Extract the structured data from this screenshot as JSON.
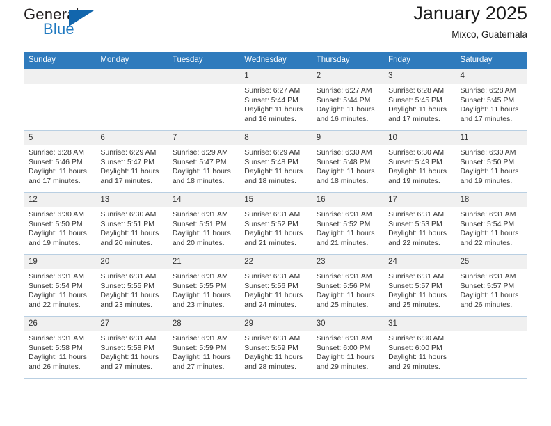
{
  "logo": {
    "word_top": "General",
    "word_bottom": "Blue",
    "triangle_color": "#1266ad",
    "blue_color": "#1f79c0"
  },
  "header": {
    "title": "January 2025",
    "subtitle": "Mixco, Guatemala"
  },
  "theme": {
    "header_row_bg": "#2f7bbd",
    "header_row_text": "#ffffff",
    "daynum_bg": "#f0f0f0",
    "cell_border": "#b9cfe2"
  },
  "calendar": {
    "weekday_headers": [
      "Sunday",
      "Monday",
      "Tuesday",
      "Wednesday",
      "Thursday",
      "Friday",
      "Saturday"
    ],
    "weeks": [
      [
        {
          "day": "",
          "empty": true,
          "sunrise": "",
          "sunset": "",
          "daylight": ""
        },
        {
          "day": "",
          "empty": true,
          "sunrise": "",
          "sunset": "",
          "daylight": ""
        },
        {
          "day": "",
          "empty": true,
          "sunrise": "",
          "sunset": "",
          "daylight": ""
        },
        {
          "day": "1",
          "sunrise": "Sunrise: 6:27 AM",
          "sunset": "Sunset: 5:44 PM",
          "daylight": "Daylight: 11 hours and 16 minutes."
        },
        {
          "day": "2",
          "sunrise": "Sunrise: 6:27 AM",
          "sunset": "Sunset: 5:44 PM",
          "daylight": "Daylight: 11 hours and 16 minutes."
        },
        {
          "day": "3",
          "sunrise": "Sunrise: 6:28 AM",
          "sunset": "Sunset: 5:45 PM",
          "daylight": "Daylight: 11 hours and 17 minutes."
        },
        {
          "day": "4",
          "sunrise": "Sunrise: 6:28 AM",
          "sunset": "Sunset: 5:45 PM",
          "daylight": "Daylight: 11 hours and 17 minutes."
        }
      ],
      [
        {
          "day": "5",
          "sunrise": "Sunrise: 6:28 AM",
          "sunset": "Sunset: 5:46 PM",
          "daylight": "Daylight: 11 hours and 17 minutes."
        },
        {
          "day": "6",
          "sunrise": "Sunrise: 6:29 AM",
          "sunset": "Sunset: 5:47 PM",
          "daylight": "Daylight: 11 hours and 17 minutes."
        },
        {
          "day": "7",
          "sunrise": "Sunrise: 6:29 AM",
          "sunset": "Sunset: 5:47 PM",
          "daylight": "Daylight: 11 hours and 18 minutes."
        },
        {
          "day": "8",
          "sunrise": "Sunrise: 6:29 AM",
          "sunset": "Sunset: 5:48 PM",
          "daylight": "Daylight: 11 hours and 18 minutes."
        },
        {
          "day": "9",
          "sunrise": "Sunrise: 6:30 AM",
          "sunset": "Sunset: 5:48 PM",
          "daylight": "Daylight: 11 hours and 18 minutes."
        },
        {
          "day": "10",
          "sunrise": "Sunrise: 6:30 AM",
          "sunset": "Sunset: 5:49 PM",
          "daylight": "Daylight: 11 hours and 19 minutes."
        },
        {
          "day": "11",
          "sunrise": "Sunrise: 6:30 AM",
          "sunset": "Sunset: 5:50 PM",
          "daylight": "Daylight: 11 hours and 19 minutes."
        }
      ],
      [
        {
          "day": "12",
          "sunrise": "Sunrise: 6:30 AM",
          "sunset": "Sunset: 5:50 PM",
          "daylight": "Daylight: 11 hours and 19 minutes."
        },
        {
          "day": "13",
          "sunrise": "Sunrise: 6:30 AM",
          "sunset": "Sunset: 5:51 PM",
          "daylight": "Daylight: 11 hours and 20 minutes."
        },
        {
          "day": "14",
          "sunrise": "Sunrise: 6:31 AM",
          "sunset": "Sunset: 5:51 PM",
          "daylight": "Daylight: 11 hours and 20 minutes."
        },
        {
          "day": "15",
          "sunrise": "Sunrise: 6:31 AM",
          "sunset": "Sunset: 5:52 PM",
          "daylight": "Daylight: 11 hours and 21 minutes."
        },
        {
          "day": "16",
          "sunrise": "Sunrise: 6:31 AM",
          "sunset": "Sunset: 5:52 PM",
          "daylight": "Daylight: 11 hours and 21 minutes."
        },
        {
          "day": "17",
          "sunrise": "Sunrise: 6:31 AM",
          "sunset": "Sunset: 5:53 PM",
          "daylight": "Daylight: 11 hours and 22 minutes."
        },
        {
          "day": "18",
          "sunrise": "Sunrise: 6:31 AM",
          "sunset": "Sunset: 5:54 PM",
          "daylight": "Daylight: 11 hours and 22 minutes."
        }
      ],
      [
        {
          "day": "19",
          "sunrise": "Sunrise: 6:31 AM",
          "sunset": "Sunset: 5:54 PM",
          "daylight": "Daylight: 11 hours and 22 minutes."
        },
        {
          "day": "20",
          "sunrise": "Sunrise: 6:31 AM",
          "sunset": "Sunset: 5:55 PM",
          "daylight": "Daylight: 11 hours and 23 minutes."
        },
        {
          "day": "21",
          "sunrise": "Sunrise: 6:31 AM",
          "sunset": "Sunset: 5:55 PM",
          "daylight": "Daylight: 11 hours and 23 minutes."
        },
        {
          "day": "22",
          "sunrise": "Sunrise: 6:31 AM",
          "sunset": "Sunset: 5:56 PM",
          "daylight": "Daylight: 11 hours and 24 minutes."
        },
        {
          "day": "23",
          "sunrise": "Sunrise: 6:31 AM",
          "sunset": "Sunset: 5:56 PM",
          "daylight": "Daylight: 11 hours and 25 minutes."
        },
        {
          "day": "24",
          "sunrise": "Sunrise: 6:31 AM",
          "sunset": "Sunset: 5:57 PM",
          "daylight": "Daylight: 11 hours and 25 minutes."
        },
        {
          "day": "25",
          "sunrise": "Sunrise: 6:31 AM",
          "sunset": "Sunset: 5:57 PM",
          "daylight": "Daylight: 11 hours and 26 minutes."
        }
      ],
      [
        {
          "day": "26",
          "sunrise": "Sunrise: 6:31 AM",
          "sunset": "Sunset: 5:58 PM",
          "daylight": "Daylight: 11 hours and 26 minutes."
        },
        {
          "day": "27",
          "sunrise": "Sunrise: 6:31 AM",
          "sunset": "Sunset: 5:58 PM",
          "daylight": "Daylight: 11 hours and 27 minutes."
        },
        {
          "day": "28",
          "sunrise": "Sunrise: 6:31 AM",
          "sunset": "Sunset: 5:59 PM",
          "daylight": "Daylight: 11 hours and 27 minutes."
        },
        {
          "day": "29",
          "sunrise": "Sunrise: 6:31 AM",
          "sunset": "Sunset: 5:59 PM",
          "daylight": "Daylight: 11 hours and 28 minutes."
        },
        {
          "day": "30",
          "sunrise": "Sunrise: 6:31 AM",
          "sunset": "Sunset: 6:00 PM",
          "daylight": "Daylight: 11 hours and 29 minutes."
        },
        {
          "day": "31",
          "sunrise": "Sunrise: 6:30 AM",
          "sunset": "Sunset: 6:00 PM",
          "daylight": "Daylight: 11 hours and 29 minutes."
        },
        {
          "day": "",
          "empty": true,
          "sunrise": "",
          "sunset": "",
          "daylight": ""
        }
      ]
    ]
  }
}
